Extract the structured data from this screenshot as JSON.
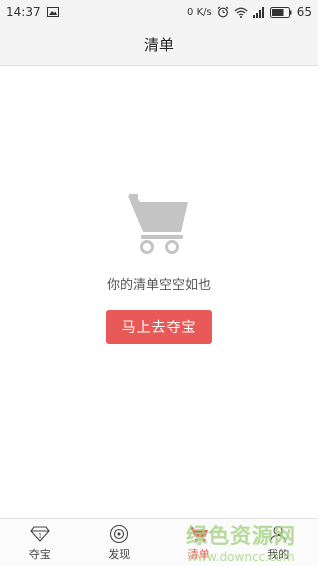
{
  "status_bar": {
    "time": "14:37",
    "network_speed": "0 K/s",
    "battery_level": "65",
    "icons": [
      "image-icon",
      "alarm-icon",
      "wifi-icon",
      "signal-icon",
      "battery-icon"
    ]
  },
  "header": {
    "title": "清单"
  },
  "empty_state": {
    "icon": "shopping-cart-icon",
    "message": "你的清单空空如也",
    "button_label": "马上去夺宝"
  },
  "tabs": [
    {
      "label": "夺宝",
      "icon": "diamond-icon",
      "active": false
    },
    {
      "label": "发现",
      "icon": "discover-icon",
      "active": false
    },
    {
      "label": "清单",
      "icon": "cart-icon",
      "active": true
    },
    {
      "label": "我的",
      "icon": "user-icon",
      "active": false
    }
  ],
  "watermark": {
    "text": "绿色资源网",
    "url": "www.downcc.com"
  },
  "colors": {
    "accent": "#e85a58",
    "header_bg": "#f4f4f4",
    "icon_gray": "#c4c4c4"
  }
}
